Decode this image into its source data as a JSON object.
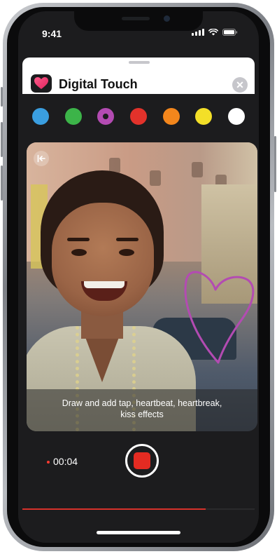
{
  "status_bar": {
    "time": "9:41"
  },
  "header": {
    "title": "Digital Touch",
    "close_label": "✕"
  },
  "palette": {
    "colors": [
      "#3a9ee0",
      "#3cb449",
      "#b34bb2",
      "#e2322b",
      "#f3861c",
      "#f3df28",
      "#ffffff"
    ],
    "selected_index": 2
  },
  "preview": {
    "caption_line1": "Draw and add tap, heartbeat, heartbreak,",
    "caption_line2": "kiss effects",
    "sketch_color": "#b34bb2"
  },
  "recording": {
    "timer": "00:04",
    "progress": 0.79
  },
  "accent": {
    "record": "#e42b22",
    "progress": "#d6322b"
  }
}
